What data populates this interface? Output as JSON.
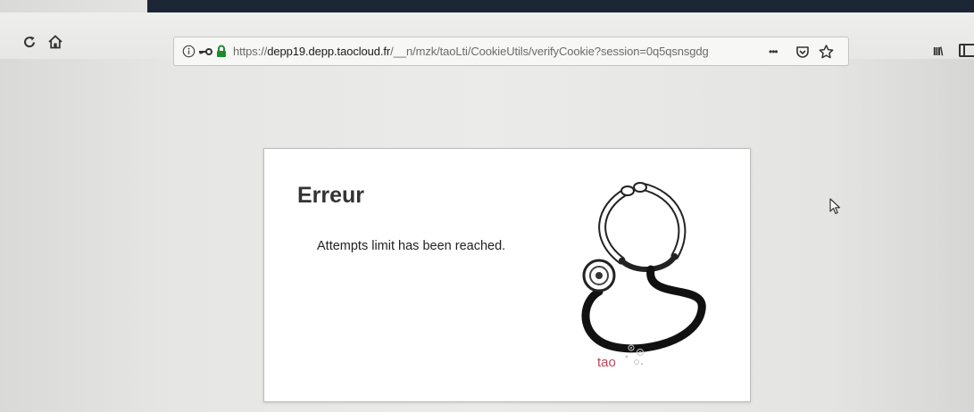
{
  "browser": {
    "url_prefix": "https://",
    "url_host": "depp19.depp.taocloud.fr",
    "url_path": "/__n/mzk/taoLti/CookieUtils/verifyCookie?session=0q5qsnsgdg",
    "icons": {
      "reload": "reload-icon",
      "home": "home-icon",
      "info": "info-icon",
      "key": "key-icon",
      "lock": "lock-icon",
      "more": "more-icon",
      "pocket": "pocket-icon",
      "bookmark": "star-icon",
      "library": "library-icon",
      "sidebar": "sidebar-icon"
    },
    "more_glyph": "•••",
    "library_glyph": "III\\"
  },
  "dialog": {
    "title": "Erreur",
    "message": "Attempts limit has been reached.",
    "illustration": "stethoscope",
    "logo_text": "tao"
  },
  "colors": {
    "logo": "#c0455b",
    "page_bg": "#ebebe9",
    "dialog_bg": "#ffffff"
  }
}
